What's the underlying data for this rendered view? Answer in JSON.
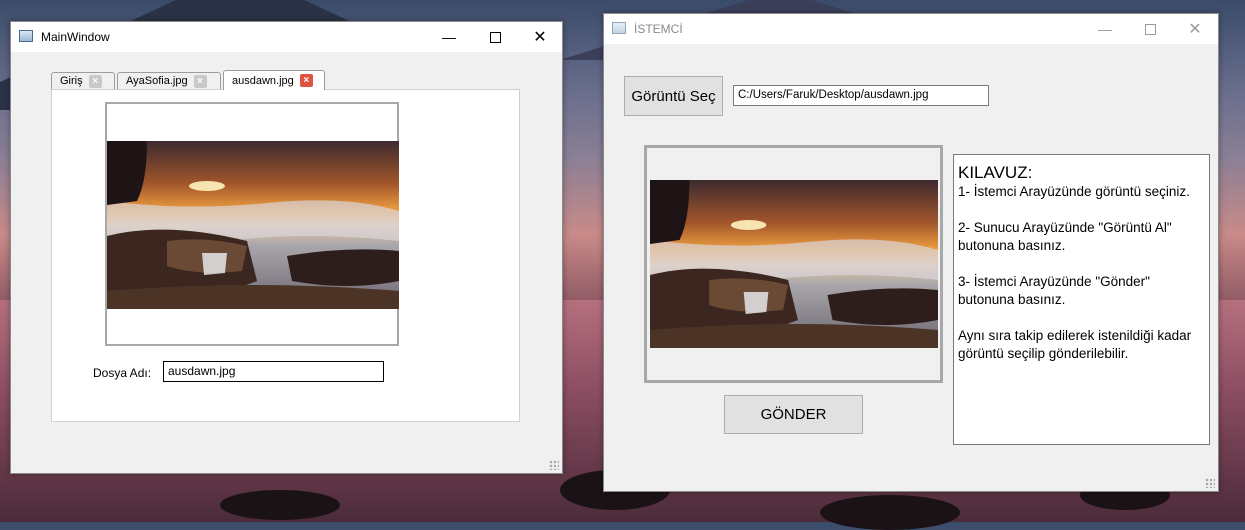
{
  "main_window": {
    "title": "MainWindow",
    "tabs": [
      {
        "label": "Giriş"
      },
      {
        "label": "AyaSofia.jpg"
      },
      {
        "label": "ausdawn.jpg"
      }
    ],
    "filename_label": "Dosya Adı:",
    "filename_value": "ausdawn.jpg"
  },
  "client_window": {
    "title": "İSTEMCİ",
    "select_button": "Görüntü Seç",
    "path_value": "C:/Users/Faruk/Desktop/ausdawn.jpg",
    "send_button": "GÖNDER",
    "guide": {
      "title": "KILAVUZ:",
      "step1": "1- İstemci Arayüzünde görüntü seçiniz.",
      "step2": "2-  Sunucu Arayüzünde \"Görüntü Al\" butonuna basınız.",
      "step3": "3- İstemci Arayüzünde \"Gönder\" butonuna basınız.",
      "note": "Aynı sıra takip edilerek istenildiği kadar görüntü seçilip gönderilebilir."
    }
  },
  "icons": {
    "minimize": "minimize-icon",
    "maximize": "maximize-icon",
    "close": "close-icon",
    "tab_close": "tab-close-icon",
    "app": "app-icon"
  },
  "colors": {
    "active_tab_close": "#e0523f",
    "window_bg": "#f0f0f0"
  }
}
